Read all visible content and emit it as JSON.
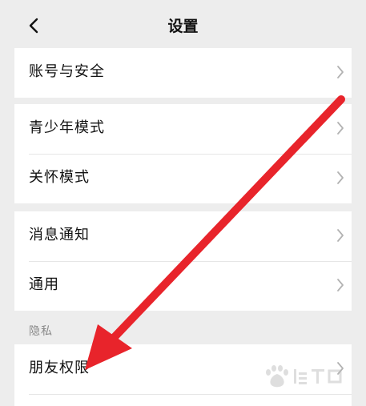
{
  "header": {
    "title": "设置"
  },
  "groups": [
    {
      "items": [
        "账号与安全"
      ]
    },
    {
      "items": [
        "青少年模式",
        "关怀模式"
      ]
    },
    {
      "items": [
        "消息通知",
        "通用"
      ]
    }
  ],
  "privacy": {
    "section_label": "隐私",
    "items": [
      "朋友权限"
    ]
  },
  "icons": {
    "back": "chevron-left-icon",
    "row_chevron": "chevron-right-icon"
  },
  "annotation": {
    "arrow_color": "#e8242b"
  },
  "colors": {
    "background": "#ededed",
    "card": "#ffffff",
    "text": "#111111",
    "section_text": "#8a8a8a",
    "chevron": "#b2b2b2"
  }
}
